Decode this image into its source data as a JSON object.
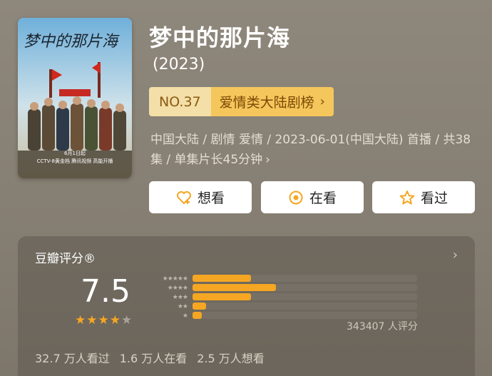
{
  "poster": {
    "title_art": "梦中的那片海",
    "promo_date": "6月1日起",
    "promo_line": "CCTV-8黄金档 腾讯视频 高能开播"
  },
  "title": "梦中的那片海",
  "year": "(2023)",
  "rank": {
    "no": "NO.37",
    "name": "爱情类大陆剧榜"
  },
  "meta": "中国大陆 / 剧情 爱情 / 2023-06-01(中国大陆) 首播 / 共38集 / 单集片长45分钟",
  "actions": {
    "want": "想看",
    "doing": "在看",
    "done": "看过"
  },
  "rating": {
    "label": "豆瓣评分®",
    "score": "7.5",
    "stars_filled": 4,
    "stars_total": 5,
    "distribution": [
      0.26,
      0.37,
      0.26,
      0.06,
      0.04
    ],
    "votes": "343407 人评分",
    "counts": [
      "32.7 万人看过",
      "1.6 万人在看",
      "2.5 万人想看"
    ]
  },
  "colors": {
    "accent": "#f5a623",
    "rank_bg": "#f5c65b",
    "background": "#8b8478"
  }
}
